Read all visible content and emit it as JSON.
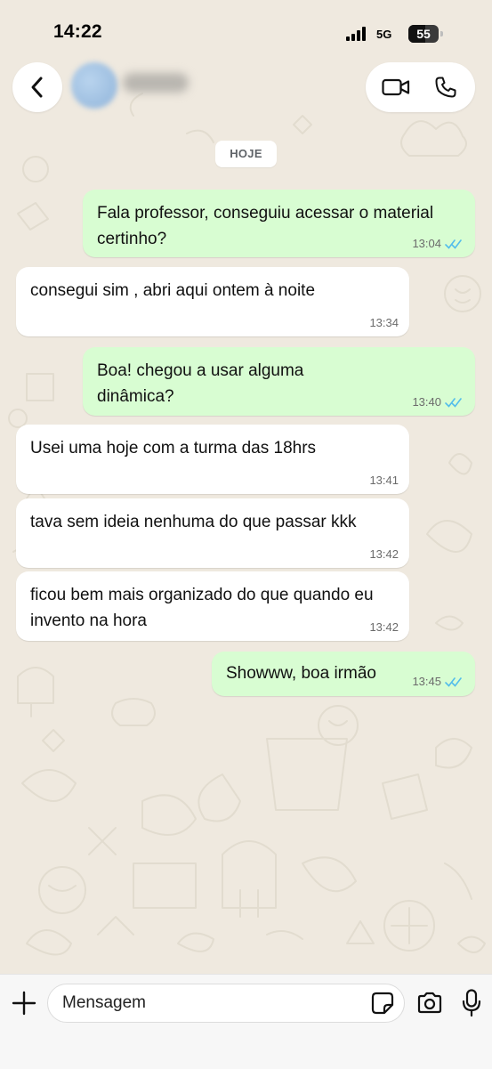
{
  "status_bar": {
    "time": "14:22",
    "network": "5G",
    "battery_level": "55",
    "battery_fraction": 0.55
  },
  "header": {
    "back_icon": "chevron-left-icon",
    "video_icon": "video-camera-icon",
    "call_icon": "phone-icon"
  },
  "date_chip": "HOJE",
  "messages": [
    {
      "direction": "out",
      "text": "Fala professor, conseguiu acessar o material certinho?",
      "time": "13:04",
      "status": "read"
    },
    {
      "direction": "in",
      "text": "consegui sim , abri aqui ontem à noite",
      "time": "13:34"
    },
    {
      "direction": "out",
      "text": "Boa! chegou a usar alguma dinâmica?",
      "time": "13:40",
      "status": "read"
    },
    {
      "direction": "in",
      "text": "Usei uma hoje com a turma das 18hrs",
      "time": "13:41"
    },
    {
      "direction": "in",
      "text": "tava sem ideia nenhuma do que passar kkk",
      "time": "13:42"
    },
    {
      "direction": "in",
      "text": "ficou bem mais organizado do que quando eu invento na hora",
      "time": "13:42"
    },
    {
      "direction": "out",
      "text": "Showww, boa irmão",
      "time": "13:45",
      "status": "read"
    }
  ],
  "colors": {
    "outgoing_bubble": "#d8fdd2",
    "incoming_bubble": "#ffffff",
    "read_receipt": "#53bdeb",
    "wallpaper": "#efe9df"
  },
  "composer": {
    "placeholder": "Mensagem",
    "attach_icon": "plus-icon",
    "sticker_icon": "sticker-icon",
    "camera_icon": "camera-icon",
    "mic_icon": "microphone-icon"
  }
}
